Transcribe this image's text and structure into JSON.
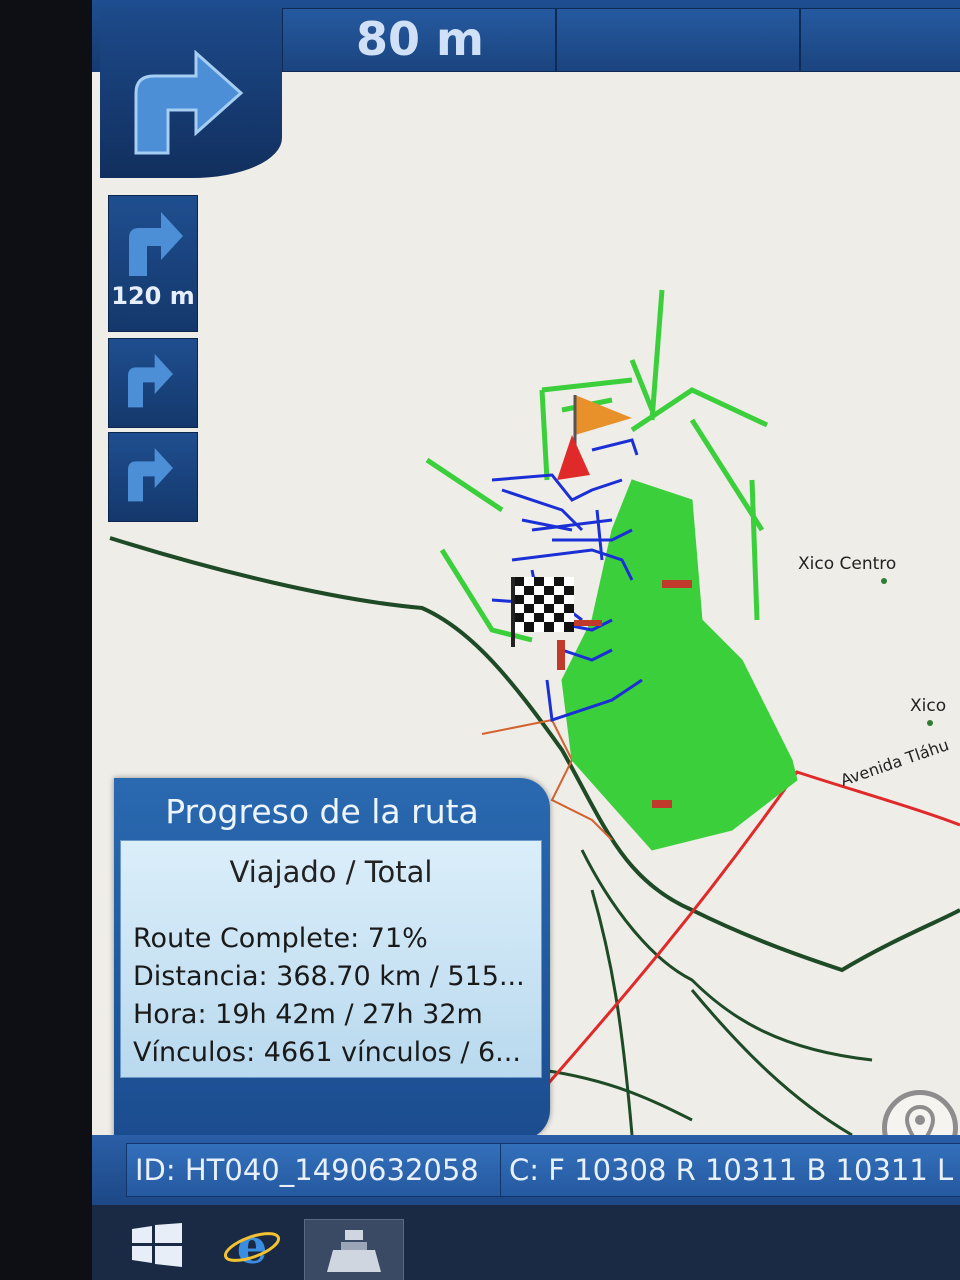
{
  "navigation": {
    "next_turn_distance": "80 m",
    "upcoming_turns": [
      {
        "distance": "120 m",
        "icon": "turn-right-icon"
      },
      {
        "distance": "",
        "icon": "turn-right-icon"
      },
      {
        "distance": "",
        "icon": "turn-right-icon"
      }
    ]
  },
  "map": {
    "labels": {
      "xico_centro": "Xico Centro",
      "xico": "Xico",
      "avenida": "Avenida Tláhu"
    }
  },
  "progress_panel": {
    "title": "Progreso de la ruta",
    "subtitle": "Viajado / Total",
    "route_complete": "Route Complete: 71%",
    "distance": "Distancia: 368.70 km / 515...",
    "time": "Hora: 19h 42m / 27h 32m",
    "links": "Vínculos: 4661 vínculos / 6..."
  },
  "status_bar": {
    "id": "ID: HT040_1490632058",
    "counts": "C: F 10308 R 10311 B 10311 L"
  },
  "colors": {
    "ui_blue": "#1c3f78",
    "route_green": "#3ccf3c",
    "route_blue": "#1a2fd6",
    "road_dark_green": "#1e4a26",
    "road_red": "#e02a2a"
  }
}
